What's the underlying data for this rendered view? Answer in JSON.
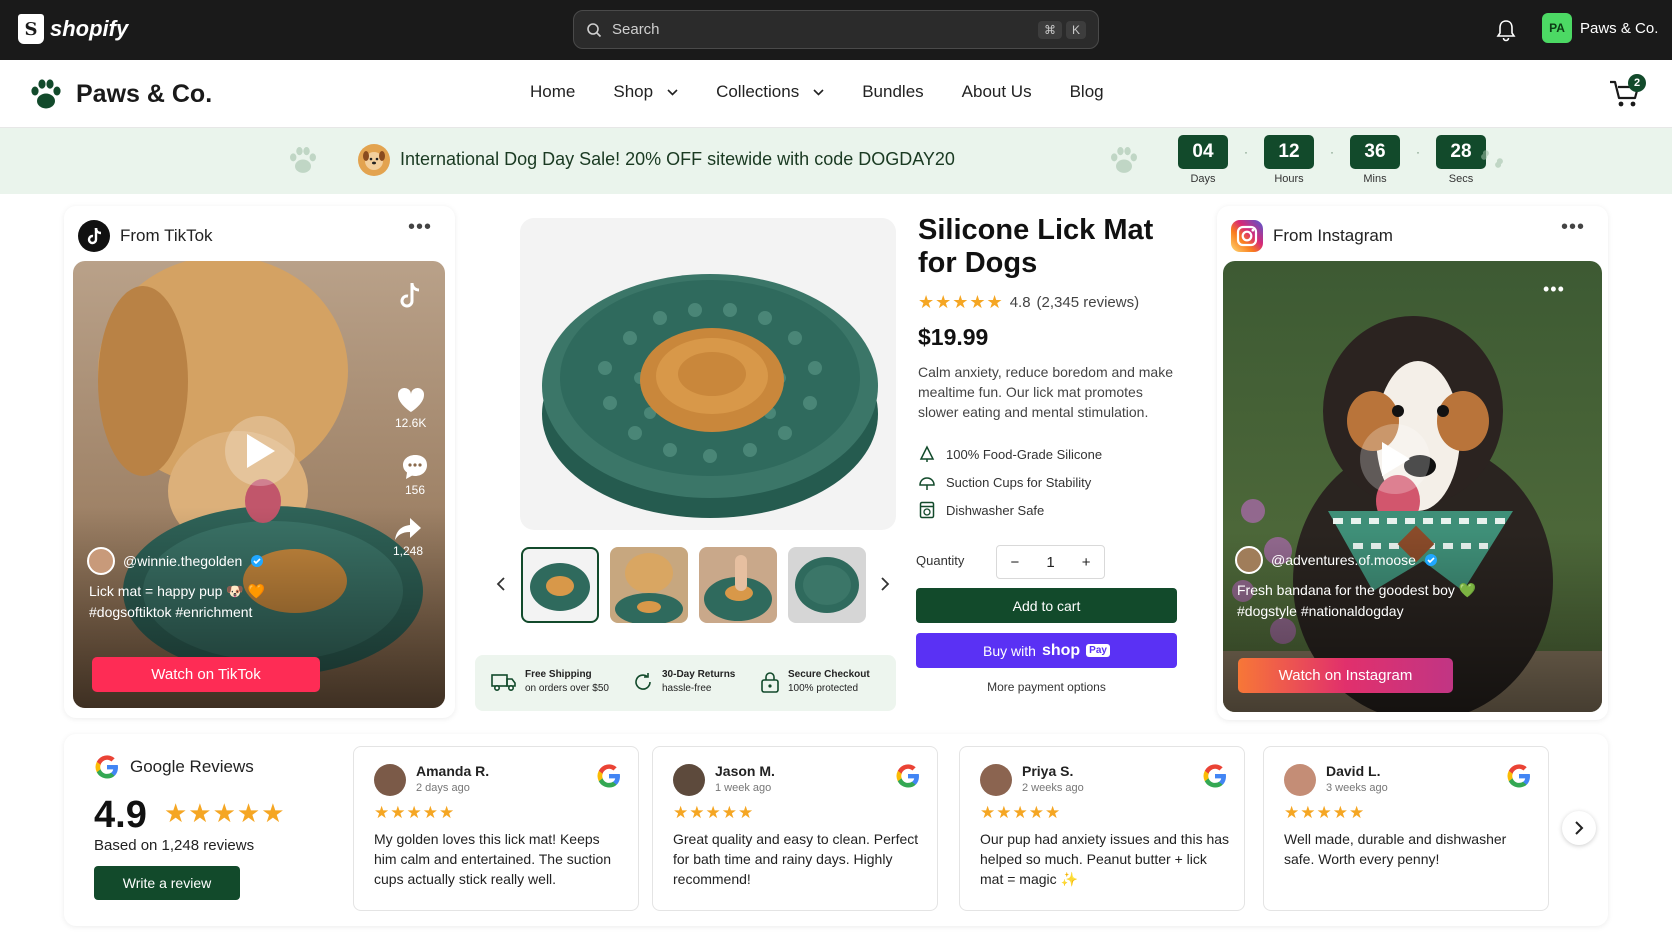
{
  "admin_bar": {
    "logo_text": "shopify",
    "search_placeholder": "Search",
    "shortcut_keys": [
      "⌘",
      "K"
    ],
    "store_initials": "PA",
    "store_name": "Paws & Co."
  },
  "header": {
    "brand": "Paws & Co.",
    "nav": [
      {
        "label": "Home"
      },
      {
        "label": "Shop"
      },
      {
        "label": "Collections"
      },
      {
        "label": "Bundles"
      },
      {
        "label": "About Us"
      },
      {
        "label": "Blog"
      }
    ],
    "cart_count": "2"
  },
  "promo": {
    "text": "International Dog Day Sale! 20% OFF sitewide with code DOGDAY20",
    "countdown": [
      {
        "value": "04",
        "label": "Days"
      },
      {
        "value": "12",
        "label": "Hours"
      },
      {
        "value": "36",
        "label": "Mins"
      },
      {
        "value": "28",
        "label": "Secs"
      }
    ]
  },
  "tiktok": {
    "title": "From TikTok",
    "likes": "12.6K",
    "comments": "156",
    "shares": "1,248",
    "handle": "@winnie.thegolden",
    "caption_line1": "Lick mat = happy pup 🐶 🧡",
    "caption_line2": "#dogsoftiktok #enrichment",
    "cta": "Watch on TikTok"
  },
  "product": {
    "title": "Silicone Lick Mat for Dogs",
    "rating": "4.8",
    "reviews": "(2,345 reviews)",
    "price": "$19.99",
    "description": "Calm anxiety, reduce boredom and make mealtime fun. Our lick mat promotes slower eating and mental stimulation.",
    "features": [
      {
        "label": "100% Food-Grade Silicone",
        "icon": "leaf-icon"
      },
      {
        "label": "Suction Cups for Stability",
        "icon": "suction-cup-icon"
      },
      {
        "label": "Dishwasher Safe",
        "icon": "dishwasher-icon"
      }
    ],
    "quantity_label": "Quantity",
    "quantity": "1",
    "add_to_cart": "Add to cart",
    "shop_pay_prefix": "Buy with",
    "shop_pay_brand": "shop",
    "shop_pay_badge": "Pay",
    "more_payment": "More payment options",
    "trust": [
      {
        "title": "Free Shipping",
        "sub": "on orders over $50",
        "icon": "truck-icon"
      },
      {
        "title": "30-Day Returns",
        "sub": "hassle-free",
        "icon": "return-icon"
      },
      {
        "title": "Secure Checkout",
        "sub": "100% protected",
        "icon": "lock-icon"
      }
    ]
  },
  "instagram": {
    "title": "From Instagram",
    "handle": "@adventures.of.moose",
    "caption_line1": "Fresh bandana for the goodest boy 💚",
    "caption_line2": "#dogstyle #nationaldogday",
    "cta": "Watch on Instagram"
  },
  "reviews": {
    "title": "Google Reviews",
    "score": "4.9",
    "count": "Based on 1,248 reviews",
    "write": "Write a review",
    "items": [
      {
        "name": "Amanda R.",
        "time": "2 days ago",
        "text": "My golden loves this lick mat! Keeps him calm and entertained. The suction cups actually stick really well."
      },
      {
        "name": "Jason M.",
        "time": "1 week ago",
        "text": "Great quality and easy to clean. Perfect for bath time and rainy days. Highly recommend!"
      },
      {
        "name": "Priya S.",
        "time": "2 weeks ago",
        "text": "Our pup had anxiety issues and this has helped so much. Peanut butter + lick mat = magic ✨"
      },
      {
        "name": "David L.",
        "time": "3 weeks ago",
        "text": "Well made, durable and dishwasher safe. Worth every penny!"
      }
    ]
  },
  "colors": {
    "brand_green": "#124a2b",
    "tiktok_pink": "#fe2c55",
    "shop_pay_purple": "#5a31f4",
    "star_gold": "#f5a623"
  }
}
